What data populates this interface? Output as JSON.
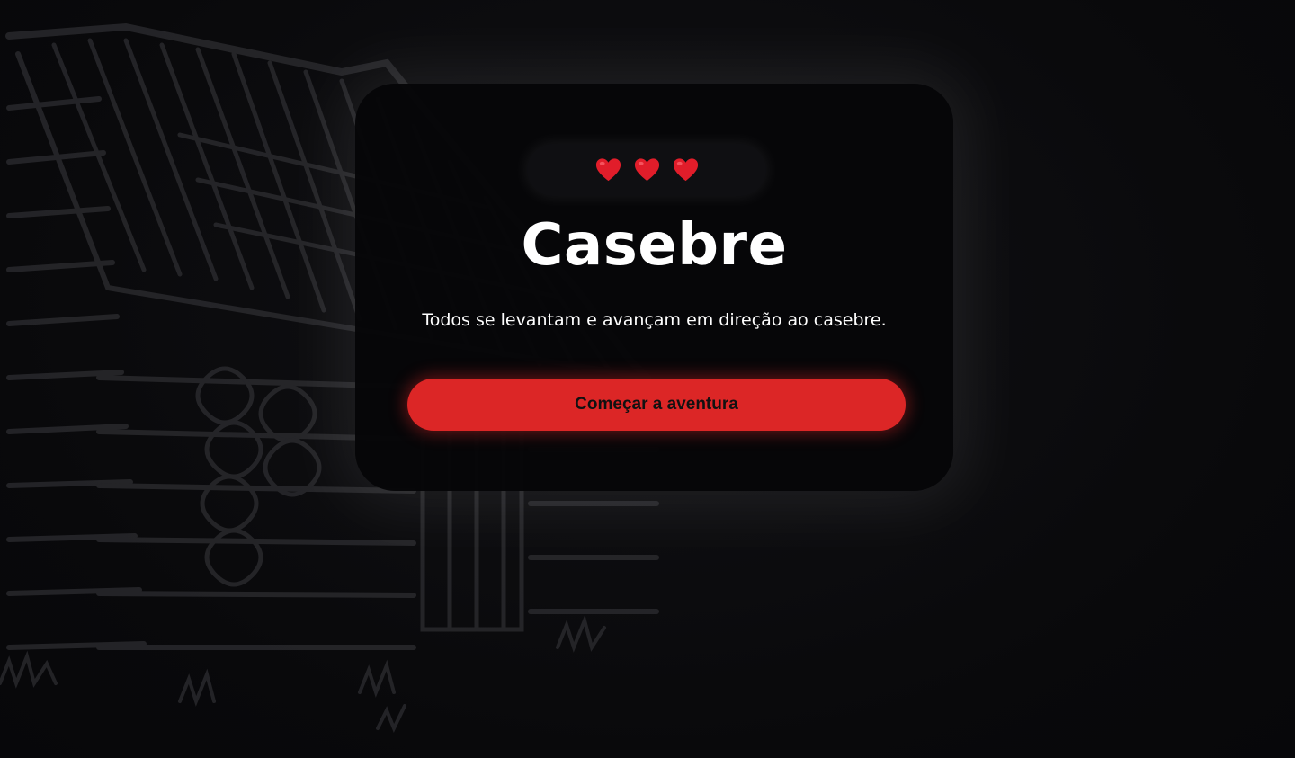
{
  "lives": {
    "count": 3,
    "icon": "heart-icon",
    "color": "#e11d2a"
  },
  "scene": {
    "title": "Casebre",
    "description": "Todos se levantam e avançam em direção ao casebre."
  },
  "actions": {
    "start_label": "Começar a aventura"
  },
  "colors": {
    "background": "#0b0b0d",
    "card": "#060608",
    "accent": "#dc2626",
    "text": "#ffffff"
  }
}
